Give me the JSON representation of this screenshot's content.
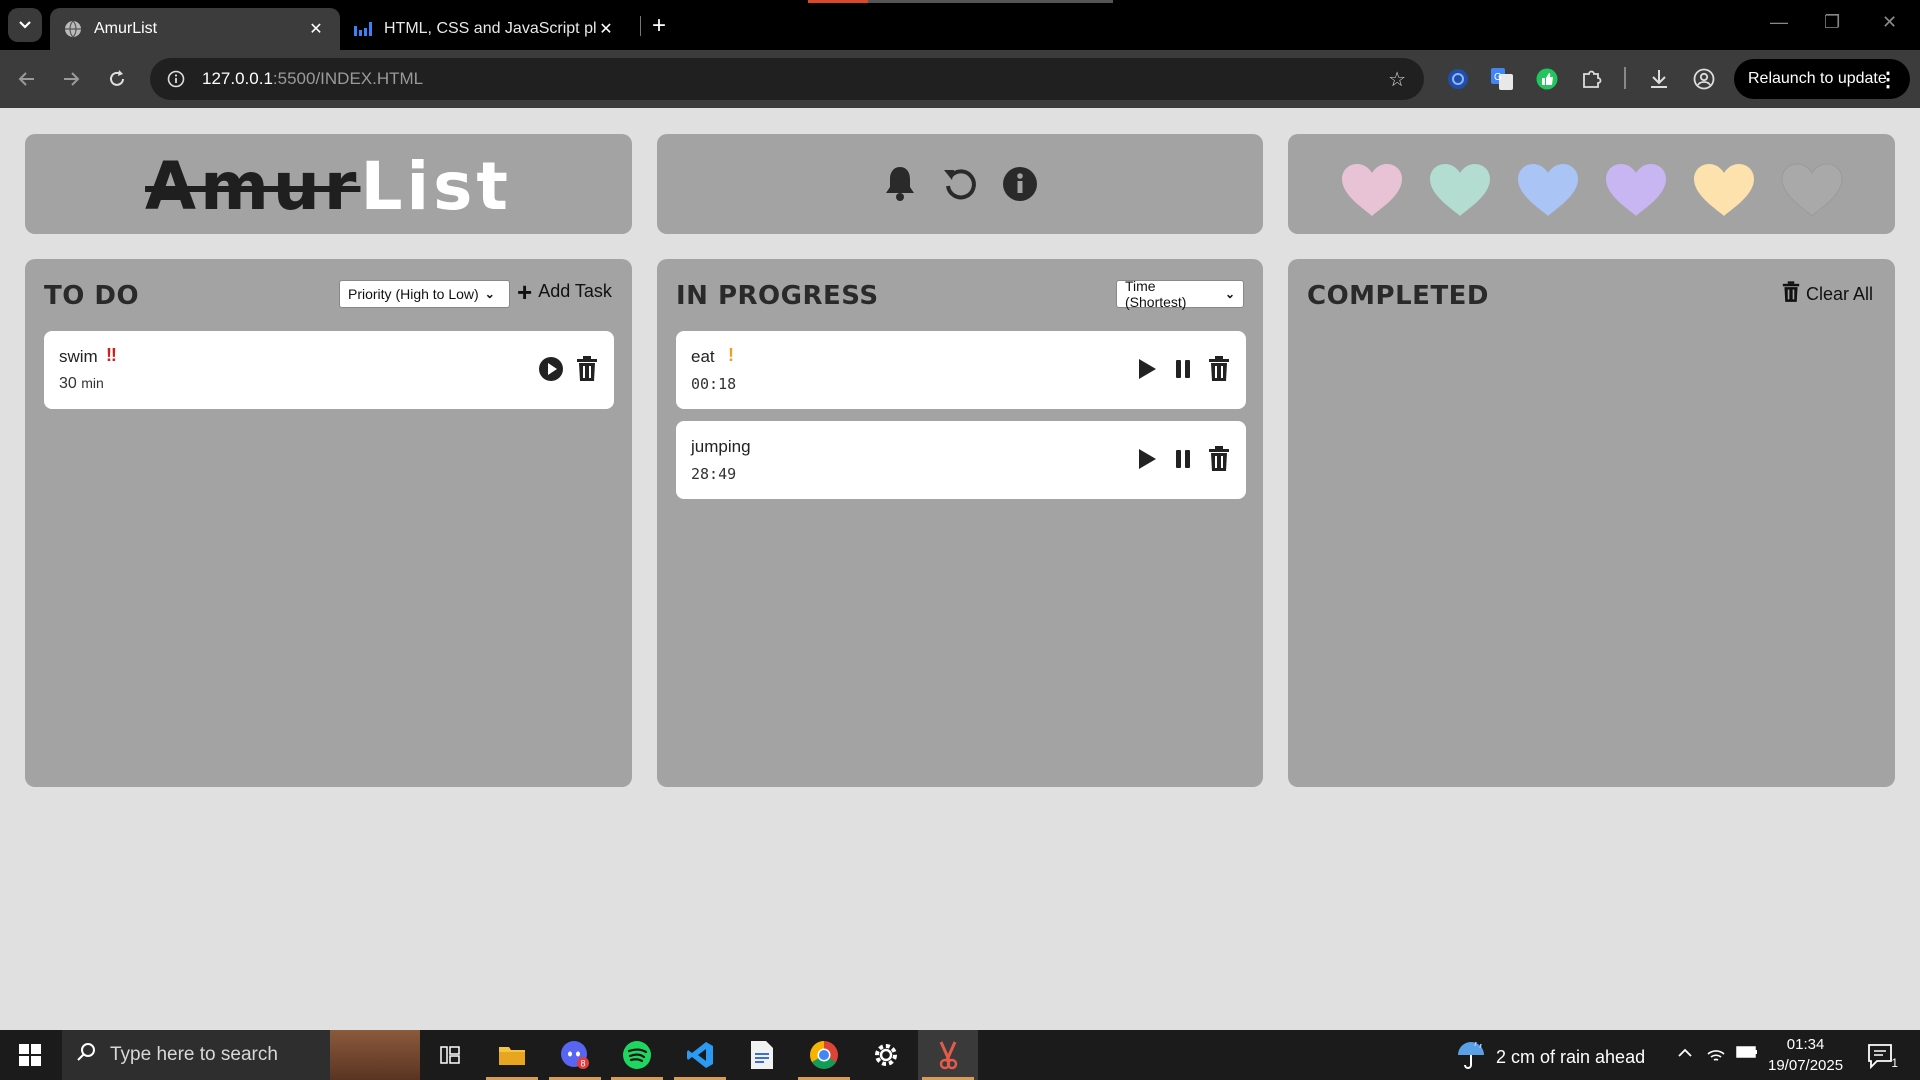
{
  "browser": {
    "tabs": [
      {
        "title": "AmurList",
        "active": true
      },
      {
        "title": "HTML, CSS and JavaScript playg",
        "active": false
      }
    ],
    "url_host": "127.0.0.1",
    "url_rest": ":5500/INDEX.HTML",
    "relaunch_label": "Relaunch to update"
  },
  "app": {
    "logo_struck": "Amur",
    "logo_plain": "List",
    "header_icons": [
      "bell-icon",
      "undo-icon",
      "info-icon"
    ],
    "heart_colors": [
      "#e8c3d6",
      "#b2ddd0",
      "#a9c4f5",
      "#c8b6f2",
      "#fde2ad",
      "#a9a9a9"
    ],
    "columns": {
      "todo": {
        "title": "TO DO",
        "sort_value": "Priority (High to Low)",
        "action_label": "Add Task",
        "tasks": [
          {
            "name": "swim",
            "priority_mark": "‼",
            "priority_color": "#d01f1f",
            "meta": "30",
            "meta_unit": "min"
          }
        ]
      },
      "in_progress": {
        "title": "IN PROGRESS",
        "sort_value": "Time (Shortest)",
        "tasks": [
          {
            "name": "eat",
            "priority_mark": "!",
            "priority_color": "#f0a020",
            "timer": "00:18"
          },
          {
            "name": "jumping",
            "priority_mark": "",
            "timer": "28:49"
          }
        ]
      },
      "completed": {
        "title": "COMPLETED",
        "action_label": "Clear All",
        "tasks": []
      }
    }
  },
  "taskbar": {
    "search_placeholder": "Type here to search",
    "weather": "2 cm of rain ahead",
    "time": "01:34",
    "date": "19/07/2025",
    "notification_count": "1",
    "discord_badge": "8"
  }
}
